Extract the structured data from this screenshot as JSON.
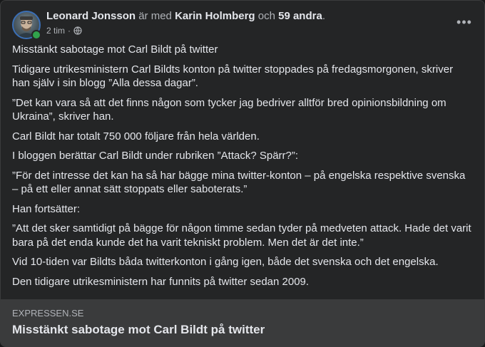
{
  "post": {
    "author": "Leonard Jonsson",
    "with_text": "är med",
    "tagged": "Karin Holmberg",
    "and_text": "och",
    "others": "59 andra",
    "period": ".",
    "time": "2 tim",
    "separator": "·",
    "privacy_icon": "globe-icon",
    "more_icon": "more-options-icon",
    "more_label": "•••"
  },
  "body": {
    "paragraphs": [
      "Misstänkt sabotage mot Carl Bildt på twitter",
      "Tidigare utrikesministern Carl Bildts konton på twitter stoppades på fredagsmorgonen, skriver han själv i sin blogg ”Alla dessa dagar”.",
      "”Det kan vara så att det finns någon som tycker jag bedriver alltför bred opinionsbildning om Ukraina”, skriver han.",
      "Carl Bildt har totalt 750 000 följare från hela världen.",
      "I bloggen berättar Carl Bildt under rubriken ”Attack? Spärr?”:",
      "”För det intresse det kan ha så har bägge mina twitter-konton – på engelska respektive svenska – på ett eller annat sätt stoppats eller saboterats.”",
      "Han fortsätter:",
      "”Att det sker samtidigt på bägge för någon timme sedan tyder på medveten attack. Hade det varit bara på det enda kunde det ha varit tekniskt problem. Men det är det inte.”",
      "Vid 10-tiden var Bildts båda twitterkonton i gång igen, både det svenska och det engelska.",
      "Den tidigare utrikesministern har funnits på twitter sedan 2009."
    ]
  },
  "link": {
    "domain": "EXPRESSEN.SE",
    "title": "Misstänkt sabotage mot Carl Bildt på twitter"
  },
  "colors": {
    "background": "#242526",
    "text_primary": "#e4e6eb",
    "text_secondary": "#b0b3b8",
    "online": "#31a24c",
    "preview_bg": "#3a3b3c"
  }
}
